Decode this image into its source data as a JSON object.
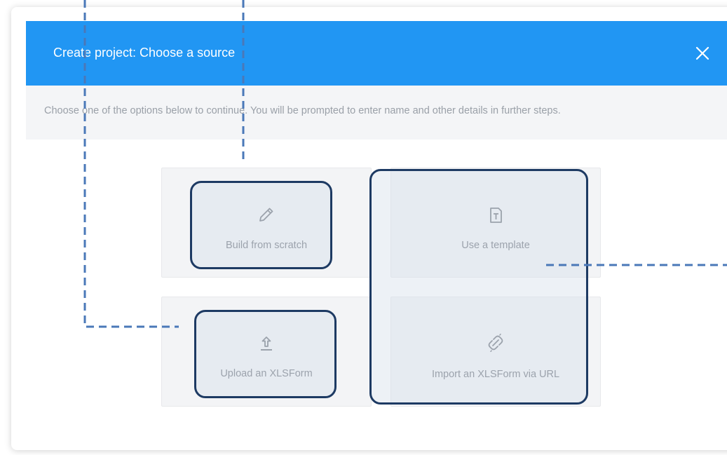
{
  "modal": {
    "title": "Create project: Choose a source",
    "description": "Choose one of the options below to continue. You will be prompted to enter name and other details in further steps.",
    "close_icon": "close-icon"
  },
  "options": [
    {
      "label": "Build from scratch",
      "icon": "pencil-icon"
    },
    {
      "label": "Use a template",
      "icon": "template-icon"
    },
    {
      "label": "Upload an XLSForm",
      "icon": "upload-icon"
    },
    {
      "label": "Import an XLSForm via URL",
      "icon": "link-icon"
    }
  ],
  "colors": {
    "header": "#2196f3",
    "highlight_border": "#1d3a63",
    "annotation_line": "#4a78b8"
  }
}
